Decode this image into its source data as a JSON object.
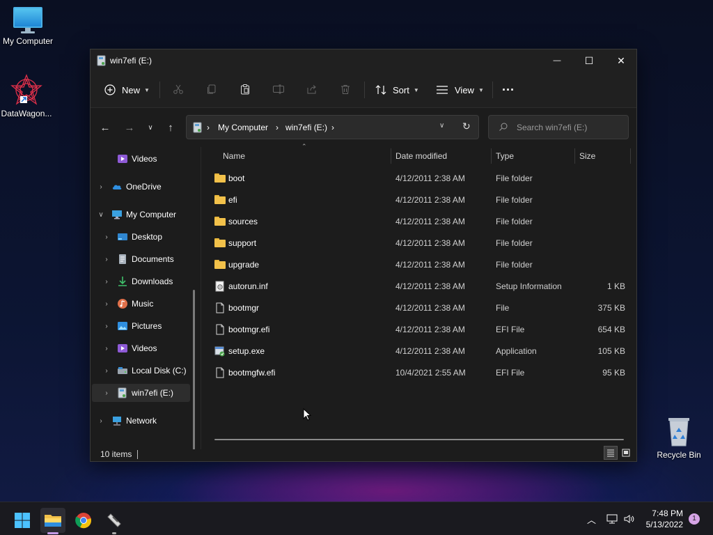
{
  "desktop": {
    "icons": [
      {
        "label": "My Computer"
      },
      {
        "label": "DataWagon..."
      },
      {
        "label": "Recycle Bin"
      }
    ]
  },
  "window": {
    "title": "win7efi (E:)",
    "controls": {
      "minimize": "—",
      "maximize": "☐",
      "close": "✕"
    }
  },
  "toolbar": {
    "new_label": "New",
    "sort_label": "Sort",
    "view_label": "View",
    "more_label": "···"
  },
  "address": {
    "segments": [
      "My Computer",
      "win7efi (E:)"
    ]
  },
  "search": {
    "placeholder": "Search win7efi (E:)"
  },
  "navpane": {
    "items": [
      {
        "label": "Videos"
      },
      {
        "label": "OneDrive"
      },
      {
        "label": "My Computer"
      },
      {
        "label": "Desktop"
      },
      {
        "label": "Documents"
      },
      {
        "label": "Downloads"
      },
      {
        "label": "Music"
      },
      {
        "label": "Pictures"
      },
      {
        "label": "Videos"
      },
      {
        "label": "Local Disk (C:)"
      },
      {
        "label": "win7efi (E:)"
      },
      {
        "label": "Network"
      }
    ]
  },
  "columns": {
    "name": "Name",
    "date": "Date modified",
    "type": "Type",
    "size": "Size"
  },
  "files": [
    {
      "name": "boot",
      "date": "4/12/2011 2:38 AM",
      "type": "File folder",
      "size": "",
      "kind": "folder"
    },
    {
      "name": "efi",
      "date": "4/12/2011 2:38 AM",
      "type": "File folder",
      "size": "",
      "kind": "folder"
    },
    {
      "name": "sources",
      "date": "4/12/2011 2:38 AM",
      "type": "File folder",
      "size": "",
      "kind": "folder"
    },
    {
      "name": "support",
      "date": "4/12/2011 2:38 AM",
      "type": "File folder",
      "size": "",
      "kind": "folder"
    },
    {
      "name": "upgrade",
      "date": "4/12/2011 2:38 AM",
      "type": "File folder",
      "size": "",
      "kind": "folder"
    },
    {
      "name": "autorun.inf",
      "date": "4/12/2011 2:38 AM",
      "type": "Setup Information",
      "size": "1 KB",
      "kind": "inf"
    },
    {
      "name": "bootmgr",
      "date": "4/12/2011 2:38 AM",
      "type": "File",
      "size": "375 KB",
      "kind": "file"
    },
    {
      "name": "bootmgr.efi",
      "date": "4/12/2011 2:38 AM",
      "type": "EFI File",
      "size": "654 KB",
      "kind": "file"
    },
    {
      "name": "setup.exe",
      "date": "4/12/2011 2:38 AM",
      "type": "Application",
      "size": "105 KB",
      "kind": "exe"
    },
    {
      "name": "bootmgfw.efi",
      "date": "10/4/2021 2:55 AM",
      "type": "EFI File",
      "size": "95 KB",
      "kind": "file"
    }
  ],
  "status": {
    "item_count": "10 items"
  },
  "taskbar": {
    "time": "7:48 PM",
    "date": "5/13/2022",
    "notification_count": "1"
  }
}
